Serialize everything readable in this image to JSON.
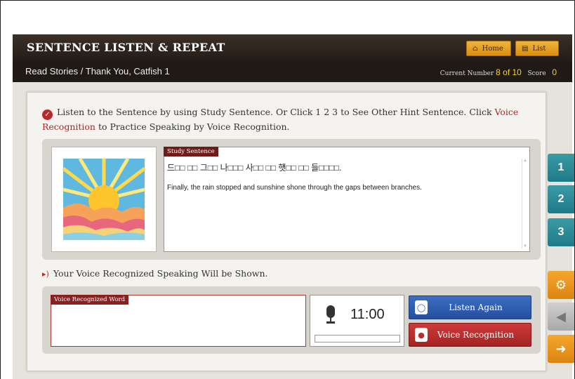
{
  "header": {
    "title": "SENTENCE LISTEN & REPEAT",
    "home_label": "Home",
    "list_label": "List"
  },
  "subheader": {
    "breadcrumb": "Read Stories / Thank You, Catfish 1",
    "current_number_label": "Current Number",
    "current_number_value": "8 of 10",
    "score_label": "Score",
    "score_value": "0"
  },
  "instruction": {
    "part1": "Listen to the Sentence by using Study Sentence. Or Click 1 2 3 to See Other Hint Sentence. Click ",
    "highlight1": "Voice Recognition",
    "part2": " to Practice Speaking by Voice Recognition."
  },
  "study": {
    "tab_label": "Study Sentence",
    "korean": "드□□ □□ 그□□ 나□□□ 사□□ □□ 햇□□ □□ 들□□□□.",
    "english": "Finally, the rain stopped and sunshine shone through the gaps between branches."
  },
  "hints": [
    "1",
    "2",
    "3"
  ],
  "voice": {
    "title": "Your Voice Recognized Speaking Will be Shown.",
    "box_label": "Voice Recognized Word",
    "timer": "11:00",
    "listen_again": "Listen Again",
    "voice_recognition": "Voice Recognition"
  },
  "colors": {
    "accent_orange": "#e99a22",
    "teal": "#2a8c98",
    "blue_button": "#2f5fb3",
    "red_button": "#b82e2e"
  },
  "icons": [
    "home-icon",
    "list-icon",
    "check-icon",
    "speaker-icon",
    "microphone-icon",
    "headphones-icon",
    "gear-icon",
    "arrow-left-icon",
    "arrow-right-icon"
  ]
}
